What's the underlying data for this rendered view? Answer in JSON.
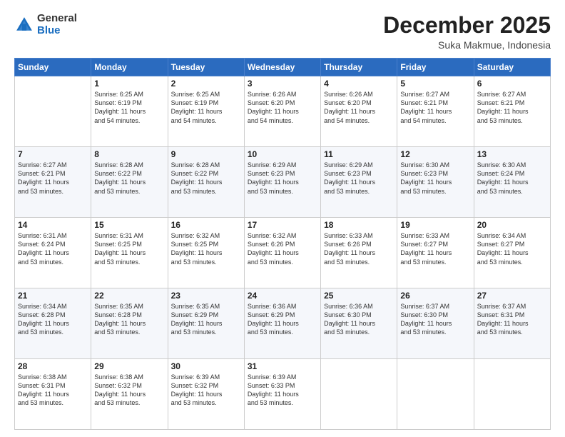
{
  "logo": {
    "general": "General",
    "blue": "Blue"
  },
  "title": {
    "month": "December 2025",
    "location": "Suka Makmue, Indonesia"
  },
  "days_of_week": [
    "Sunday",
    "Monday",
    "Tuesday",
    "Wednesday",
    "Thursday",
    "Friday",
    "Saturday"
  ],
  "weeks": [
    [
      {
        "day": "",
        "info": ""
      },
      {
        "day": "1",
        "info": "Sunrise: 6:25 AM\nSunset: 6:19 PM\nDaylight: 11 hours\nand 54 minutes."
      },
      {
        "day": "2",
        "info": "Sunrise: 6:25 AM\nSunset: 6:19 PM\nDaylight: 11 hours\nand 54 minutes."
      },
      {
        "day": "3",
        "info": "Sunrise: 6:26 AM\nSunset: 6:20 PM\nDaylight: 11 hours\nand 54 minutes."
      },
      {
        "day": "4",
        "info": "Sunrise: 6:26 AM\nSunset: 6:20 PM\nDaylight: 11 hours\nand 54 minutes."
      },
      {
        "day": "5",
        "info": "Sunrise: 6:27 AM\nSunset: 6:21 PM\nDaylight: 11 hours\nand 54 minutes."
      },
      {
        "day": "6",
        "info": "Sunrise: 6:27 AM\nSunset: 6:21 PM\nDaylight: 11 hours\nand 53 minutes."
      }
    ],
    [
      {
        "day": "7",
        "info": "Sunrise: 6:27 AM\nSunset: 6:21 PM\nDaylight: 11 hours\nand 53 minutes."
      },
      {
        "day": "8",
        "info": "Sunrise: 6:28 AM\nSunset: 6:22 PM\nDaylight: 11 hours\nand 53 minutes."
      },
      {
        "day": "9",
        "info": "Sunrise: 6:28 AM\nSunset: 6:22 PM\nDaylight: 11 hours\nand 53 minutes."
      },
      {
        "day": "10",
        "info": "Sunrise: 6:29 AM\nSunset: 6:23 PM\nDaylight: 11 hours\nand 53 minutes."
      },
      {
        "day": "11",
        "info": "Sunrise: 6:29 AM\nSunset: 6:23 PM\nDaylight: 11 hours\nand 53 minutes."
      },
      {
        "day": "12",
        "info": "Sunrise: 6:30 AM\nSunset: 6:23 PM\nDaylight: 11 hours\nand 53 minutes."
      },
      {
        "day": "13",
        "info": "Sunrise: 6:30 AM\nSunset: 6:24 PM\nDaylight: 11 hours\nand 53 minutes."
      }
    ],
    [
      {
        "day": "14",
        "info": "Sunrise: 6:31 AM\nSunset: 6:24 PM\nDaylight: 11 hours\nand 53 minutes."
      },
      {
        "day": "15",
        "info": "Sunrise: 6:31 AM\nSunset: 6:25 PM\nDaylight: 11 hours\nand 53 minutes."
      },
      {
        "day": "16",
        "info": "Sunrise: 6:32 AM\nSunset: 6:25 PM\nDaylight: 11 hours\nand 53 minutes."
      },
      {
        "day": "17",
        "info": "Sunrise: 6:32 AM\nSunset: 6:26 PM\nDaylight: 11 hours\nand 53 minutes."
      },
      {
        "day": "18",
        "info": "Sunrise: 6:33 AM\nSunset: 6:26 PM\nDaylight: 11 hours\nand 53 minutes."
      },
      {
        "day": "19",
        "info": "Sunrise: 6:33 AM\nSunset: 6:27 PM\nDaylight: 11 hours\nand 53 minutes."
      },
      {
        "day": "20",
        "info": "Sunrise: 6:34 AM\nSunset: 6:27 PM\nDaylight: 11 hours\nand 53 minutes."
      }
    ],
    [
      {
        "day": "21",
        "info": "Sunrise: 6:34 AM\nSunset: 6:28 PM\nDaylight: 11 hours\nand 53 minutes."
      },
      {
        "day": "22",
        "info": "Sunrise: 6:35 AM\nSunset: 6:28 PM\nDaylight: 11 hours\nand 53 minutes."
      },
      {
        "day": "23",
        "info": "Sunrise: 6:35 AM\nSunset: 6:29 PM\nDaylight: 11 hours\nand 53 minutes."
      },
      {
        "day": "24",
        "info": "Sunrise: 6:36 AM\nSunset: 6:29 PM\nDaylight: 11 hours\nand 53 minutes."
      },
      {
        "day": "25",
        "info": "Sunrise: 6:36 AM\nSunset: 6:30 PM\nDaylight: 11 hours\nand 53 minutes."
      },
      {
        "day": "26",
        "info": "Sunrise: 6:37 AM\nSunset: 6:30 PM\nDaylight: 11 hours\nand 53 minutes."
      },
      {
        "day": "27",
        "info": "Sunrise: 6:37 AM\nSunset: 6:31 PM\nDaylight: 11 hours\nand 53 minutes."
      }
    ],
    [
      {
        "day": "28",
        "info": "Sunrise: 6:38 AM\nSunset: 6:31 PM\nDaylight: 11 hours\nand 53 minutes."
      },
      {
        "day": "29",
        "info": "Sunrise: 6:38 AM\nSunset: 6:32 PM\nDaylight: 11 hours\nand 53 minutes."
      },
      {
        "day": "30",
        "info": "Sunrise: 6:39 AM\nSunset: 6:32 PM\nDaylight: 11 hours\nand 53 minutes."
      },
      {
        "day": "31",
        "info": "Sunrise: 6:39 AM\nSunset: 6:33 PM\nDaylight: 11 hours\nand 53 minutes."
      },
      {
        "day": "",
        "info": ""
      },
      {
        "day": "",
        "info": ""
      },
      {
        "day": "",
        "info": ""
      }
    ]
  ]
}
